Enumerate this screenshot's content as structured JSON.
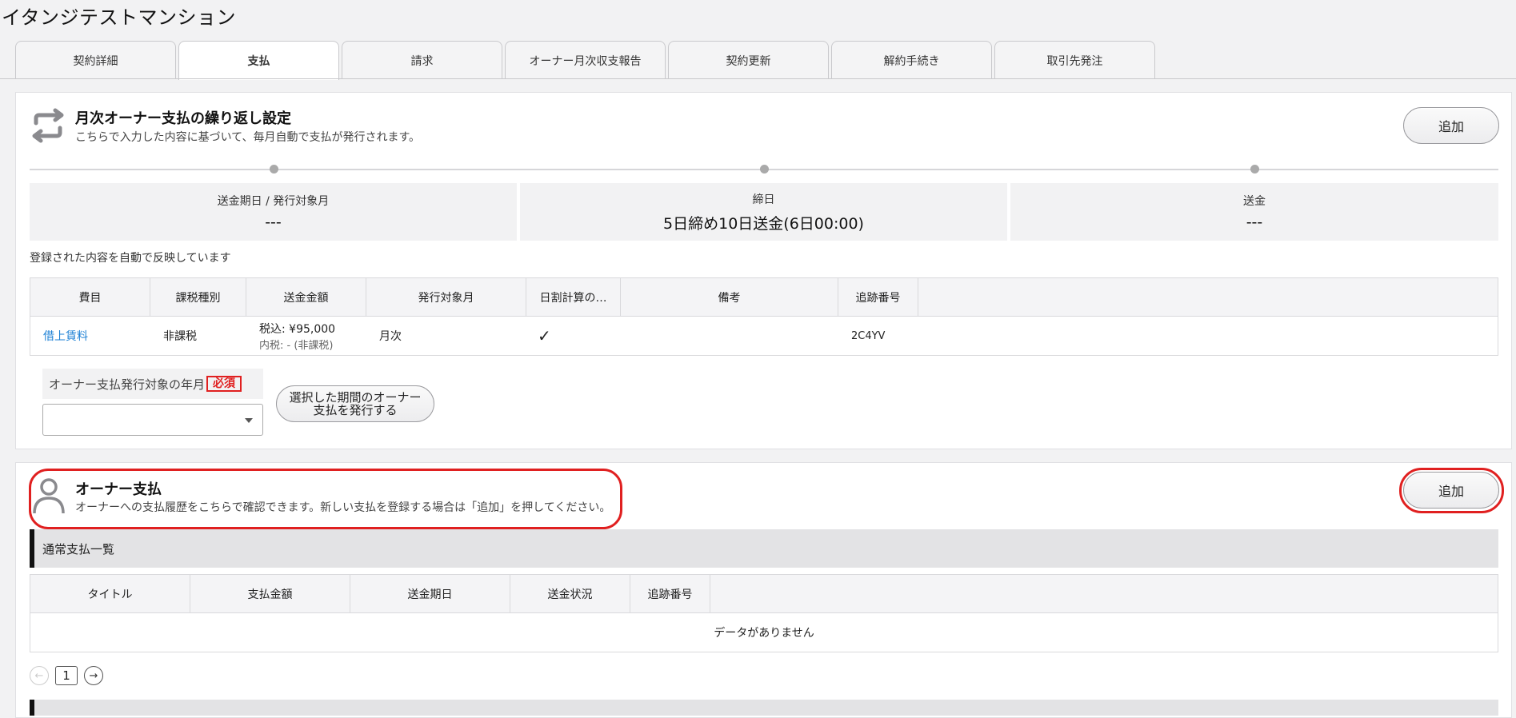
{
  "page": {
    "title": "イタンジテストマンション"
  },
  "tabs": [
    {
      "label": "契約詳細",
      "active": false
    },
    {
      "label": "支払",
      "active": true
    },
    {
      "label": "請求",
      "active": false
    },
    {
      "label": "オーナー月次収支報告",
      "active": false
    },
    {
      "label": "契約更新",
      "active": false
    },
    {
      "label": "解約手続き",
      "active": false
    },
    {
      "label": "取引先発注",
      "active": false
    }
  ],
  "recurring": {
    "title": "月次オーナー支払の繰り返し設定",
    "description": "こちらで入力した内容に基づいて、毎月自動で支払が発行されます。",
    "add_label": "追加",
    "steps": [
      {
        "label": "送金期日 / 発行対象月",
        "value": "---"
      },
      {
        "label": "締日",
        "value": "5日締め10日送金(6日00:00)"
      },
      {
        "label": "送金",
        "value": "---"
      }
    ],
    "note": "登録された内容を自動で反映しています",
    "table": {
      "headers": [
        "費目",
        "課税種別",
        "送金金額",
        "発行対象月",
        "日割計算の…",
        "備考",
        "追跡番号"
      ],
      "rows": [
        {
          "item": "借上賃料",
          "tax_type": "非課税",
          "amount": "税込: ¥95,000",
          "amount_sub": "内税: - (非課税)",
          "target_month": "月次",
          "prorate": "✓",
          "memo": "",
          "tracking": "2C4YV"
        }
      ]
    },
    "issue_field": {
      "label": "オーナー支払発行対象の年月",
      "required": "必須",
      "value": "",
      "button_label": "選択した期間のオーナー支払を発行する"
    }
  },
  "owner_payment": {
    "title": "オーナー支払",
    "description": "オーナーへの支払履歴をこちらで確認できます。新しい支払を登録する場合は「追加」を押してください。",
    "add_label": "追加",
    "section_title": "通常支払一覧",
    "table": {
      "headers": [
        "タイトル",
        "支払金額",
        "送金期日",
        "送金状況",
        "追跡番号"
      ],
      "empty": "データがありません"
    },
    "pager": {
      "page": "1",
      "prev": "←",
      "next": "→"
    }
  },
  "colors": {
    "highlight": "#e02020",
    "link": "#1a7fd4"
  }
}
